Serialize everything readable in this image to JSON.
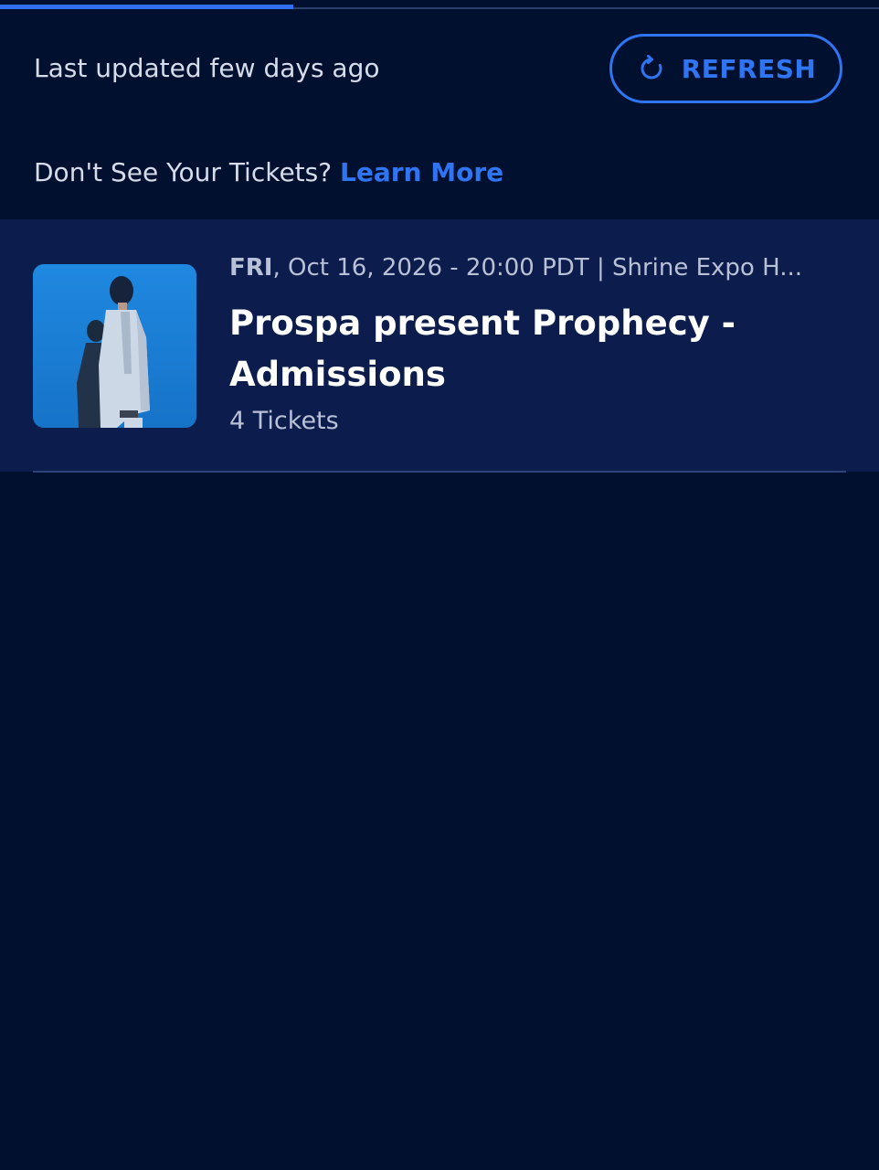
{
  "header": {
    "last_updated": "Last updated few days ago",
    "refresh_label": "REFRESH",
    "refresh_icon": "refresh-icon"
  },
  "help": {
    "prompt": "Don't See Your Tickets? ",
    "link_label": "Learn More"
  },
  "events": [
    {
      "day": "FRI",
      "date_venue": ", Oct 16, 2026 - 20:00 PDT | Shrine Expo H...",
      "title": "Prospa present Prophecy - Admissions",
      "ticket_count": "4 Tickets"
    }
  ],
  "colors": {
    "background": "#01102f",
    "card": "#0c1c4c",
    "accent": "#2f74f0"
  }
}
